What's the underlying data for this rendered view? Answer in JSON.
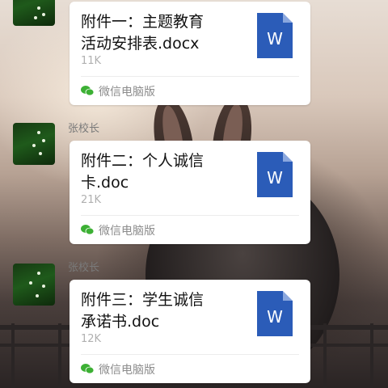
{
  "messages": [
    {
      "sender": "",
      "file_name_line1": "附件一：主题教育",
      "file_name_line2": "活动安排表.docx",
      "size": "11K",
      "source": "微信电脑版",
      "file_icon_label": "W"
    },
    {
      "sender": "张校长",
      "file_name_line1": "附件二：个人诚信",
      "file_name_line2": "卡.doc",
      "size": "21K",
      "source": "微信电脑版",
      "file_icon_label": "W"
    },
    {
      "sender": "张校长",
      "file_name_line1": "附件三：学生诚信",
      "file_name_line2": "承诺书.doc",
      "size": "12K",
      "source": "微信电脑版",
      "file_icon_label": "W"
    }
  ],
  "colors": {
    "word_icon": "#2b5cb8",
    "wechat_green": "#3cb034",
    "card_bg": "#ffffff"
  },
  "icons": [
    "avatar-image",
    "word-document-icon",
    "wechat-icon"
  ]
}
